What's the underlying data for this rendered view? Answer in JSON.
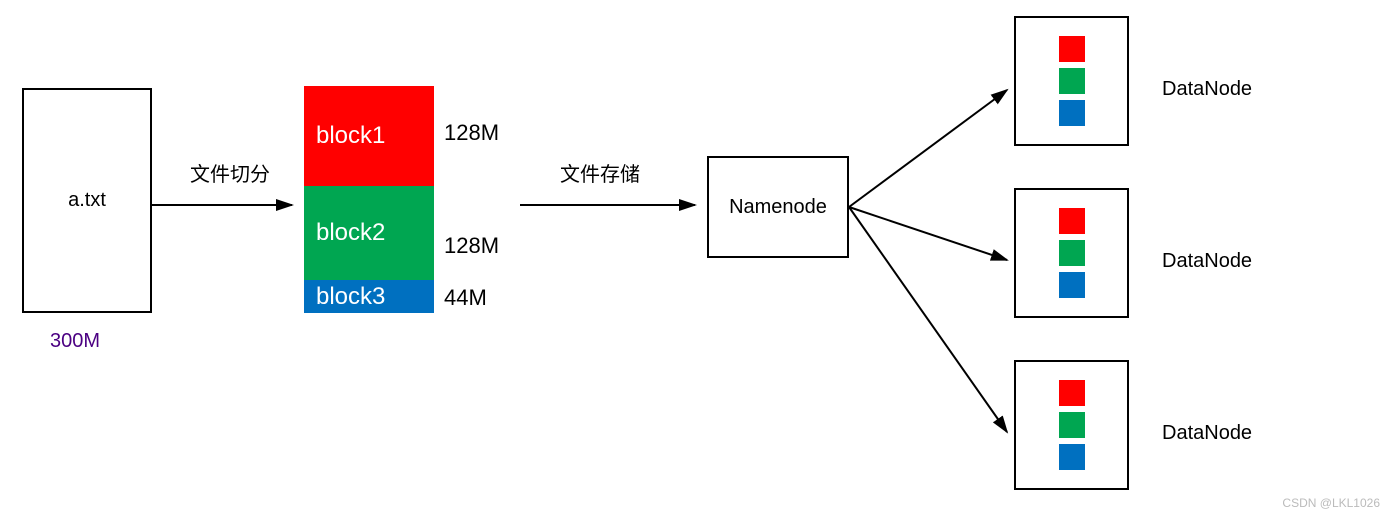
{
  "file": {
    "name": "a.txt",
    "size": "300M"
  },
  "arrow_labels": {
    "split": "文件切分",
    "store": "文件存储"
  },
  "blocks": [
    {
      "name": "block1",
      "size": "128M",
      "color": "red"
    },
    {
      "name": "block2",
      "size": "128M",
      "color": "green"
    },
    {
      "name": "block3",
      "size": "44M",
      "color": "blue"
    }
  ],
  "namenode": "Namenode",
  "datanodes": [
    {
      "label": "DataNode",
      "contents": [
        "red",
        "green",
        "blue"
      ]
    },
    {
      "label": "DataNode",
      "contents": [
        "red",
        "green",
        "blue"
      ]
    },
    {
      "label": "DataNode",
      "contents": [
        "red",
        "green",
        "blue"
      ]
    }
  ],
  "watermark": "CSDN @LKL1026"
}
